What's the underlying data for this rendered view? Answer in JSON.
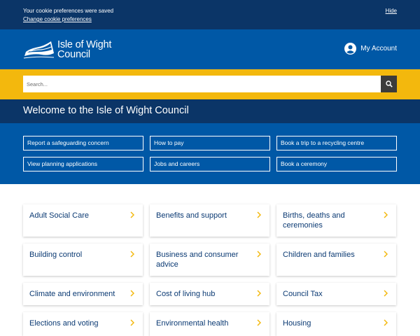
{
  "cookie_bar": {
    "message": "Your cookie preferences were saved",
    "change_link": "Change cookie preferences",
    "hide_link": "Hide"
  },
  "header": {
    "logo_line1": "Isle of Wight",
    "logo_line2": "Council",
    "account_label": "My Account"
  },
  "search": {
    "placeholder": "Search...",
    "button_icon": "search-icon"
  },
  "welcome": {
    "title": "Welcome to the Isle of Wight Council"
  },
  "quick_links": [
    "Report a safeguarding concern",
    "How to pay",
    "Book a trip to a recycling centre",
    "View planning applications",
    "Jobs and careers",
    "Book a ceremony"
  ],
  "services": [
    "Adult Social Care",
    "Benefits and support",
    "Births, deaths and ceremonies",
    "Building control",
    "Business and consumer advice",
    "Children and families",
    "Climate and environment",
    "Cost of living hub",
    "Council Tax",
    "Elections and voting",
    "Environmental health",
    "Housing"
  ],
  "colors": {
    "dark_navy": "#0b3567",
    "brand_blue": "#0058a6",
    "accent_yellow": "#f3b80d",
    "chevron": "#f3b80d"
  }
}
